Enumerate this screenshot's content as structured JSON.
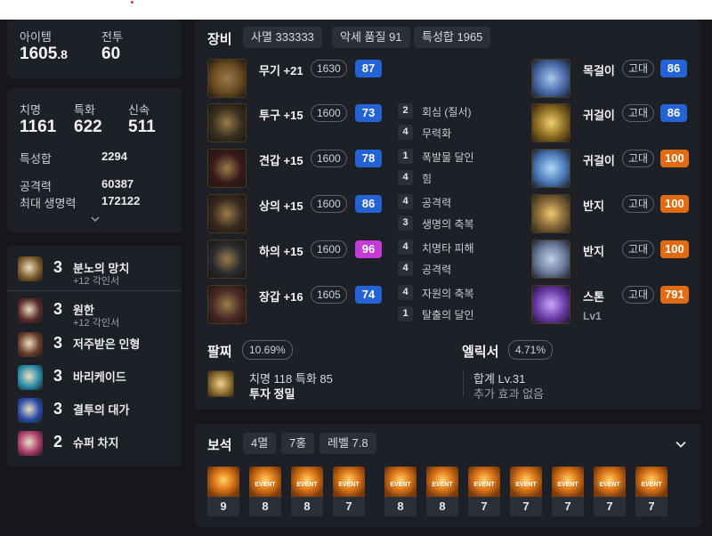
{
  "stats": {
    "item_level_label": "아이템",
    "item_level_main": "1605",
    "item_level_frac": ".8",
    "combat_label": "전투",
    "combat_value": "60",
    "crit_label": "치명",
    "crit_value": "1161",
    "spec_label": "특화",
    "spec_value": "622",
    "swift_label": "신속",
    "swift_value": "511",
    "stat_sum_label": "특성합",
    "stat_sum_value": "2294",
    "attack_label": "공격력",
    "attack_value": "60387",
    "hp_label": "최대 생명력",
    "hp_value": "172122",
    "expand_icon": "chevron-down"
  },
  "engravings": [
    {
      "level": "3",
      "name": "분노의 망치",
      "sub": "+12 각인서",
      "color": "#7a5a2a"
    },
    {
      "level": "3",
      "name": "원한",
      "sub": "+12 각인서",
      "color": "#5a2a2a"
    },
    {
      "level": "3",
      "name": "저주받은 인형",
      "sub": "",
      "color": "#6a3a2a"
    },
    {
      "level": "3",
      "name": "바리케이드",
      "sub": "",
      "color": "#2a8aa8"
    },
    {
      "level": "3",
      "name": "결투의 대가",
      "sub": "",
      "color": "#2a4aa8"
    },
    {
      "level": "2",
      "name": "슈퍼 차지",
      "sub": "",
      "color": "#a83a6a"
    }
  ],
  "equipment": {
    "title": "장비",
    "tags": [
      "사멸 333333",
      "악세 품질 91",
      "특성합 1965"
    ],
    "items": [
      {
        "name": "무기 +21",
        "ilvl": "1630",
        "quality": "87",
        "qcolor": "blue",
        "sets": []
      },
      {
        "name": "투구 +15",
        "ilvl": "1600",
        "quality": "73",
        "qcolor": "blue",
        "sets": [
          {
            "n": "2",
            "t": "회심 (질서)"
          },
          {
            "n": "4",
            "t": "무력화"
          }
        ]
      },
      {
        "name": "견갑 +15",
        "ilvl": "1600",
        "quality": "78",
        "qcolor": "blue",
        "sets": [
          {
            "n": "1",
            "t": "폭발물 달인"
          },
          {
            "n": "4",
            "t": "힘"
          }
        ]
      },
      {
        "name": "상의 +15",
        "ilvl": "1600",
        "quality": "86",
        "qcolor": "blue",
        "sets": [
          {
            "n": "4",
            "t": "공격력"
          },
          {
            "n": "3",
            "t": "생명의 축복"
          }
        ]
      },
      {
        "name": "하의 +15",
        "ilvl": "1600",
        "quality": "96",
        "qcolor": "magenta",
        "sets": [
          {
            "n": "4",
            "t": "치명타 피해"
          },
          {
            "n": "4",
            "t": "공격력"
          }
        ]
      },
      {
        "name": "장갑 +16",
        "ilvl": "1605",
        "quality": "74",
        "qcolor": "blue",
        "sets": [
          {
            "n": "4",
            "t": "자원의 축복"
          },
          {
            "n": "1",
            "t": "탈출의 달인"
          }
        ]
      }
    ],
    "accessories": [
      {
        "name": "목걸이",
        "grade": "고대",
        "quality": "86",
        "qcolor": "blue",
        "sub": ""
      },
      {
        "name": "귀걸이",
        "grade": "고대",
        "quality": "86",
        "qcolor": "blue",
        "sub": ""
      },
      {
        "name": "귀걸이",
        "grade": "고대",
        "quality": "100",
        "qcolor": "orange",
        "sub": ""
      },
      {
        "name": "반지",
        "grade": "고대",
        "quality": "100",
        "qcolor": "orange",
        "sub": ""
      },
      {
        "name": "반지",
        "grade": "고대",
        "quality": "100",
        "qcolor": "orange",
        "sub": ""
      },
      {
        "name": "스톤",
        "grade": "고대",
        "quality": "791",
        "qcolor": "orange",
        "sub": "Lv1"
      }
    ],
    "bracelet": {
      "title": "팔찌",
      "percent": "10.69%",
      "line1": "치명 118  특화 85",
      "line2": "투자  정밀"
    },
    "elixir": {
      "title": "엘릭서",
      "percent": "4.71%",
      "line1": "합계 Lv.31",
      "line2": "추가 효과 없음"
    }
  },
  "gems": {
    "title": "보석",
    "tags": [
      "4멸",
      "7홍",
      "레벨 7.8"
    ],
    "expand_icon": "chevron-down",
    "items": [
      {
        "level": "9",
        "event": false
      },
      {
        "level": "8",
        "event": true
      },
      {
        "level": "8",
        "event": true
      },
      {
        "level": "7",
        "event": true
      },
      {
        "level": "8",
        "event": true
      },
      {
        "level": "8",
        "event": true
      },
      {
        "level": "7",
        "event": true
      },
      {
        "level": "7",
        "event": true
      },
      {
        "level": "7",
        "event": true
      },
      {
        "level": "7",
        "event": true
      },
      {
        "level": "7",
        "event": true
      }
    ]
  }
}
